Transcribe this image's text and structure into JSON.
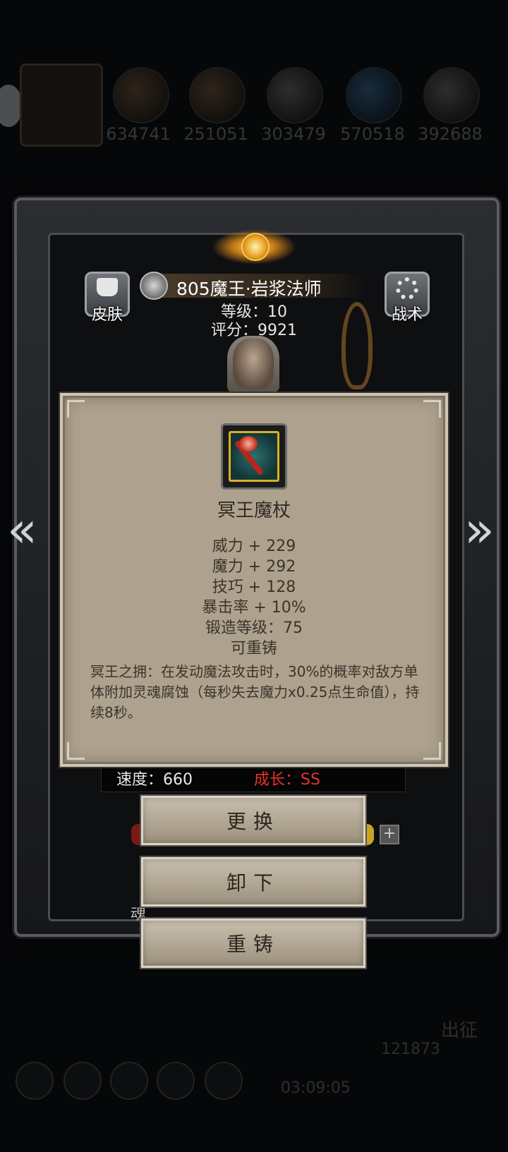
{
  "resources": [
    "634741",
    "251051",
    "303479",
    "570518",
    "392688"
  ],
  "hero": {
    "name": "805魔王·岩浆法师",
    "level": "等级：10",
    "score": "评分：9921",
    "skin_label": "皮肤",
    "tactics_label": "战术"
  },
  "item": {
    "name": "冥王魔杖",
    "stats": [
      "威力 + 229",
      "魔力 + 292",
      "技巧 + 128",
      "暴击率 + 10%",
      "锻造等级：75",
      "可重铸"
    ],
    "description": "冥王之拥：在发动魔法攻击时，30%的概率对敌方单体附加灵魂腐蚀（每秒失去魔力x0.25点生命值），持续8秒。"
  },
  "attributes": {
    "speed": "速度：660",
    "growth": "成长：SS",
    "growth_color": "#e8332a"
  },
  "actions": {
    "replace": "更换",
    "unequip": "卸下",
    "reforge": "重铸"
  },
  "background": {
    "soul_label": "魂",
    "timer": "03:09:05",
    "currency": "121873",
    "depart": "出征"
  }
}
